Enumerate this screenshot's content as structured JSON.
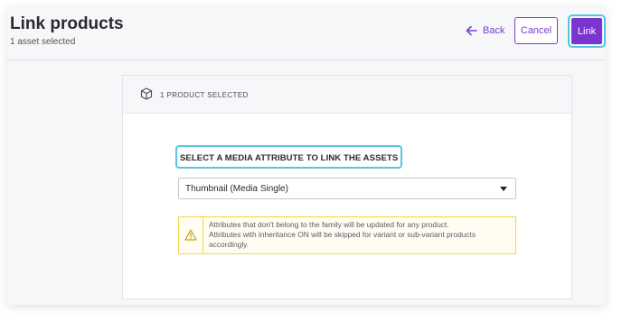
{
  "header": {
    "title": "Link products",
    "subtitle": "1 asset selected",
    "back_label": "Back",
    "cancel_label": "Cancel",
    "link_label": "Link"
  },
  "panel": {
    "selected_count": "1 PRODUCT SELECTED",
    "attribute_label": "SELECT A MEDIA ATTRIBUTE TO LINK THE ASSETS",
    "attribute_select": {
      "value": "Thumbnail (Media Single)"
    },
    "warning": {
      "line1": "Attributes that don't belong to the family will be updated for any product.",
      "line2": "Attributes with inheritance ON will be skipped for variant or sub-variant products",
      "line3": "accordingly."
    }
  },
  "colors": {
    "accent": "#7a34cf",
    "focus_ring": "#58c6de",
    "warning_border": "#f2d64a"
  },
  "icons": [
    "arrow-left-icon",
    "box-icon",
    "caret-down-icon",
    "warning-icon"
  ]
}
